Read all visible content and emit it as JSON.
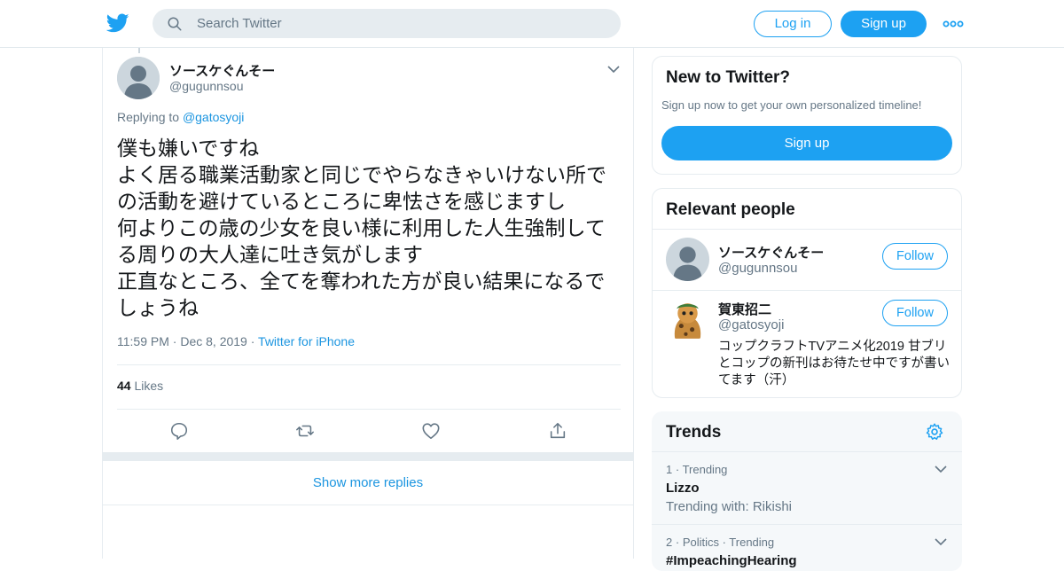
{
  "header": {
    "search_placeholder": "Search Twitter",
    "login_label": "Log in",
    "signup_label": "Sign up",
    "brand_color": "#1DA1F2"
  },
  "tweet": {
    "author_name": "ソースケぐんそー",
    "author_handle": "@gugunnsou",
    "replying_prefix": "Replying to ",
    "replying_handle": "@gatosyoji",
    "text": "僕も嫌いですね\nよく居る職業活動家と同じでやらなきゃいけない所での活動を避けているところに卑怯さを感じますし\n何よりこの歳の少女を良い様に利用した人生強制してる周りの大人達に吐き気がします\n正直なところ、全てを奪われた方が良い結果になるでしょうね",
    "time": "11:59 PM",
    "date": "Dec 8, 2019",
    "source": "Twitter for iPhone",
    "likes_count": "44",
    "likes_label": "Likes"
  },
  "show_more_replies": "Show more replies",
  "new_to_twitter": {
    "title": "New to Twitter?",
    "subtitle": "Sign up now to get your own personalized timeline!",
    "signup_label": "Sign up"
  },
  "relevant_people": {
    "title": "Relevant people",
    "people": [
      {
        "name": "ソースケぐんそー",
        "handle": "@gugunnsou",
        "follow_label": "Follow",
        "bio": ""
      },
      {
        "name": "賀東招二",
        "handle": "@gatosyoji",
        "follow_label": "Follow",
        "bio": "コップクラフトTVアニメ化2019 甘ブリとコップの新刊はお待たせ中ですが書いてます（汗）"
      }
    ]
  },
  "trends": {
    "title": "Trends",
    "items": [
      {
        "rank": "1",
        "category": "Trending",
        "name": "Lizzo",
        "with": "Trending with: Rikishi"
      },
      {
        "rank": "2",
        "category": "Politics · Trending",
        "name": "#ImpeachingHearing",
        "with": ""
      }
    ]
  }
}
